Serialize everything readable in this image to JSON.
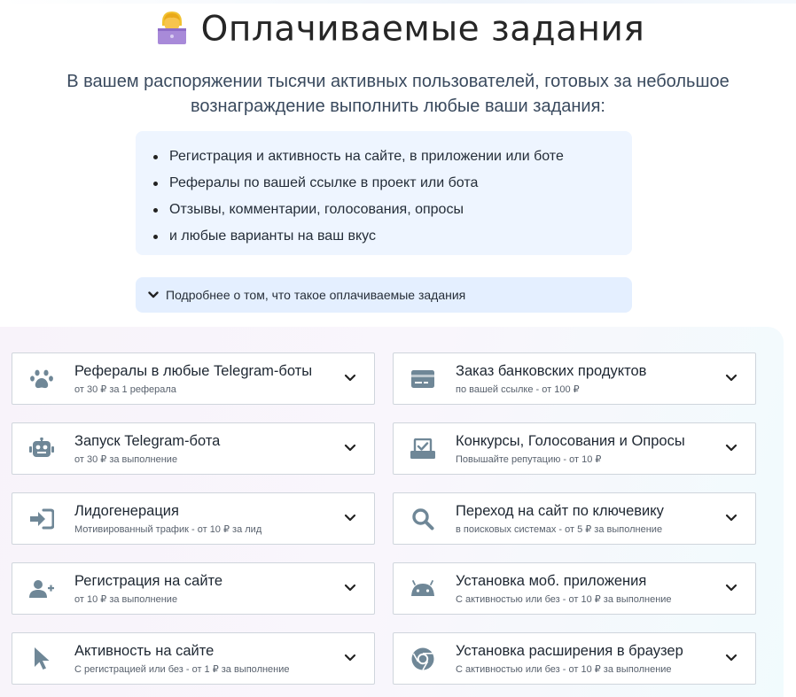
{
  "header": {
    "title": "Оплачиваемые задания",
    "subtitle_line1": "В вашем распоряжении тысячи активных пользователей, готовых за небольшое",
    "subtitle_line2": "вознаграждение выполнить любые ваши задания:"
  },
  "bullets": [
    "Регистрация и активность на сайте, в приложении или боте",
    "Рефералы по вашей ссылке в проект или бота",
    "Отзывы, комментарии, голосования, опросы",
    "и любые варианты на ваш вкус"
  ],
  "more_label": "Подробнее о том, что такое оплачиваемые задания",
  "cards": [
    {
      "title": "Рефералы в любые Telegram-боты",
      "subtitle": "от 30 ₽ за 1 реферала",
      "icon": "paw-icon"
    },
    {
      "title": "Заказ банковских продуктов",
      "subtitle": "по вашей ссылке - от 100 ₽",
      "icon": "credit-card-icon"
    },
    {
      "title": "Запуск Telegram-бота",
      "subtitle": "от 30 ₽ за выполнение",
      "icon": "robot-icon"
    },
    {
      "title": "Конкурсы, Голосования и Опросы",
      "subtitle": "Повышайте репутацию - от 10 ₽",
      "icon": "vote-box-icon"
    },
    {
      "title": "Лидогенерация",
      "subtitle": "Мотивированный трафик - от 10 ₽ за лид",
      "icon": "sign-in-icon"
    },
    {
      "title": "Переход на сайт по ключевику",
      "subtitle": "в поисковых системах - от 5 ₽ за выполнение",
      "icon": "search-icon"
    },
    {
      "title": "Регистрация на сайте",
      "subtitle": "от 10 ₽ за выполнение",
      "icon": "user-plus-icon"
    },
    {
      "title": "Установка моб. приложения",
      "subtitle": "С активностью или без - от 10 ₽ за выполнение",
      "icon": "android-icon"
    },
    {
      "title": "Активность на сайте",
      "subtitle": "С регистрацией или без - от 1 ₽ за выполнение",
      "icon": "cursor-icon"
    },
    {
      "title": "Установка расширения в браузер",
      "subtitle": "С активностью или без - от 10 ₽ за выполнение",
      "icon": "chrome-icon"
    }
  ],
  "colors": {
    "icon": "#6f8797",
    "bullet_box": "#eef5ff",
    "more_box": "#e4efff",
    "card_border": "#cfd5dc"
  }
}
